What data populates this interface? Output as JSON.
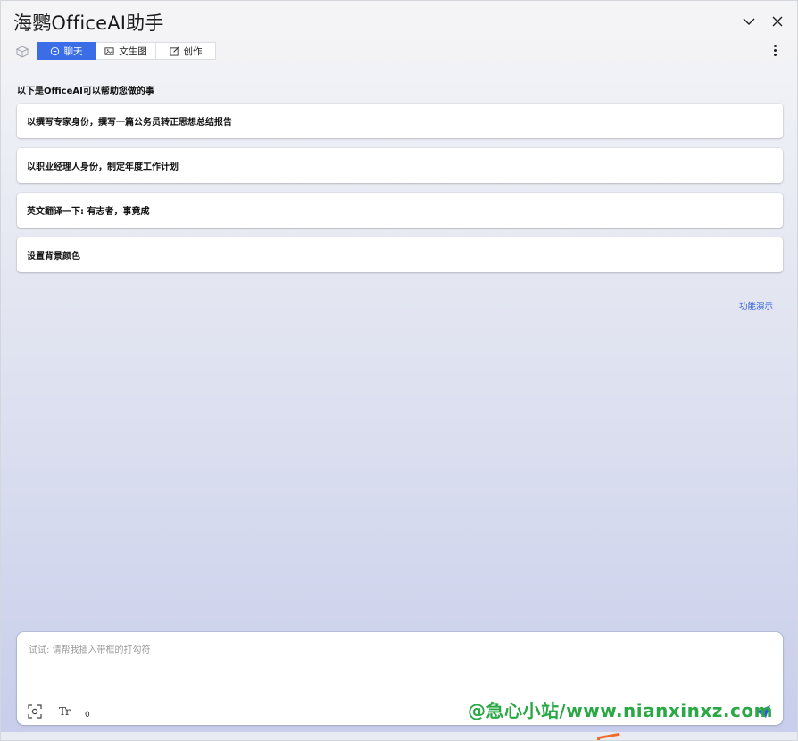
{
  "app": {
    "title": "海鹦OfficeAI助手"
  },
  "window_controls": {
    "collapse_icon": "chevron-down-icon",
    "close_icon": "close-icon"
  },
  "tabs": [
    {
      "label": "聊天",
      "icon": "chat-icon",
      "active": true
    },
    {
      "label": "文生图",
      "icon": "image-icon",
      "active": false
    },
    {
      "label": "创作",
      "icon": "edit-icon",
      "active": false
    }
  ],
  "main": {
    "intro": "以下是OfficeAI可以帮助您做的事",
    "suggestions": [
      "以撰写专家身份，撰写一篇公务员转正思想总结报告",
      "以职业经理人身份，制定年度工作计划",
      "英文翻译一下: 有志者，事竟成",
      "设置背景颜色"
    ],
    "demo_link": "功能演示"
  },
  "input": {
    "placeholder": "试试: 请帮我插入带框的打勾符",
    "value": "",
    "font_button": "Tr",
    "char_count": "0"
  },
  "watermark": "@急心小站/www.nianxinxz.com",
  "colors": {
    "accent": "#3a6de6",
    "link": "#2f5bd8",
    "watermark": "#2aa845"
  }
}
